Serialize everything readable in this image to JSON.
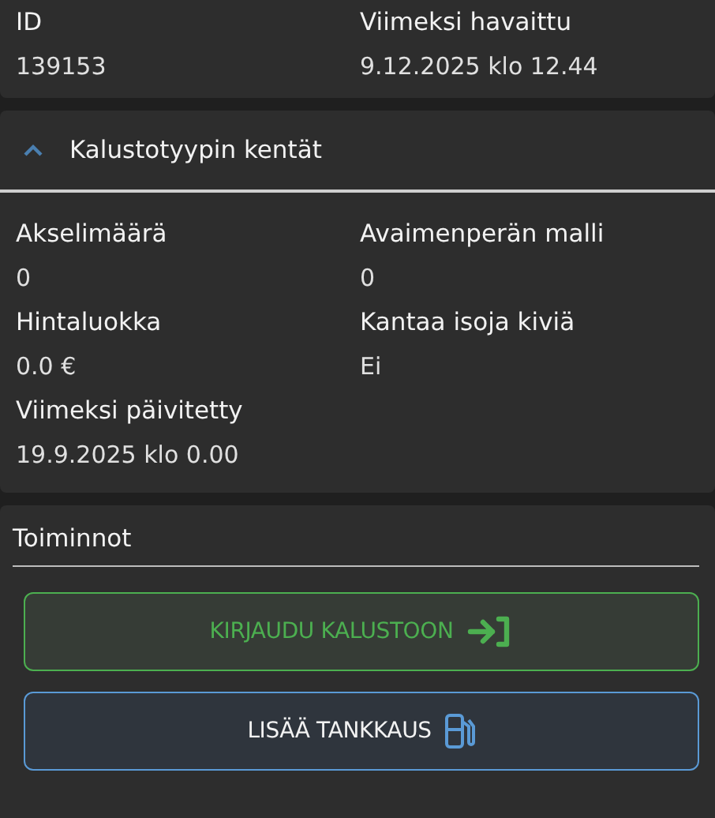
{
  "summary": {
    "fields": [
      {
        "label": "ID",
        "value": "139153"
      },
      {
        "label": "Viimeksi havaittu",
        "value": "9.12.2025 klo 12.44"
      }
    ]
  },
  "type_fields": {
    "title": "Kalustotyypin kentät",
    "expanded": true,
    "fields": [
      {
        "label": "Akselimäärä",
        "value": "0"
      },
      {
        "label": "Avaimenperän malli",
        "value": "0"
      },
      {
        "label": "Hintaluokka",
        "value": "0.0 €"
      },
      {
        "label": "Kantaa isoja kiviä",
        "value": "Ei"
      },
      {
        "label": "Viimeksi päivitetty",
        "value": "19.9.2025 klo 0.00"
      }
    ]
  },
  "actions": {
    "title": "Toiminnot",
    "buttons": [
      {
        "label": "KIRJAUDU KALUSTOON",
        "kind": "login"
      },
      {
        "label": "LISÄÄ TANKKAUS",
        "kind": "fuel"
      }
    ]
  }
}
